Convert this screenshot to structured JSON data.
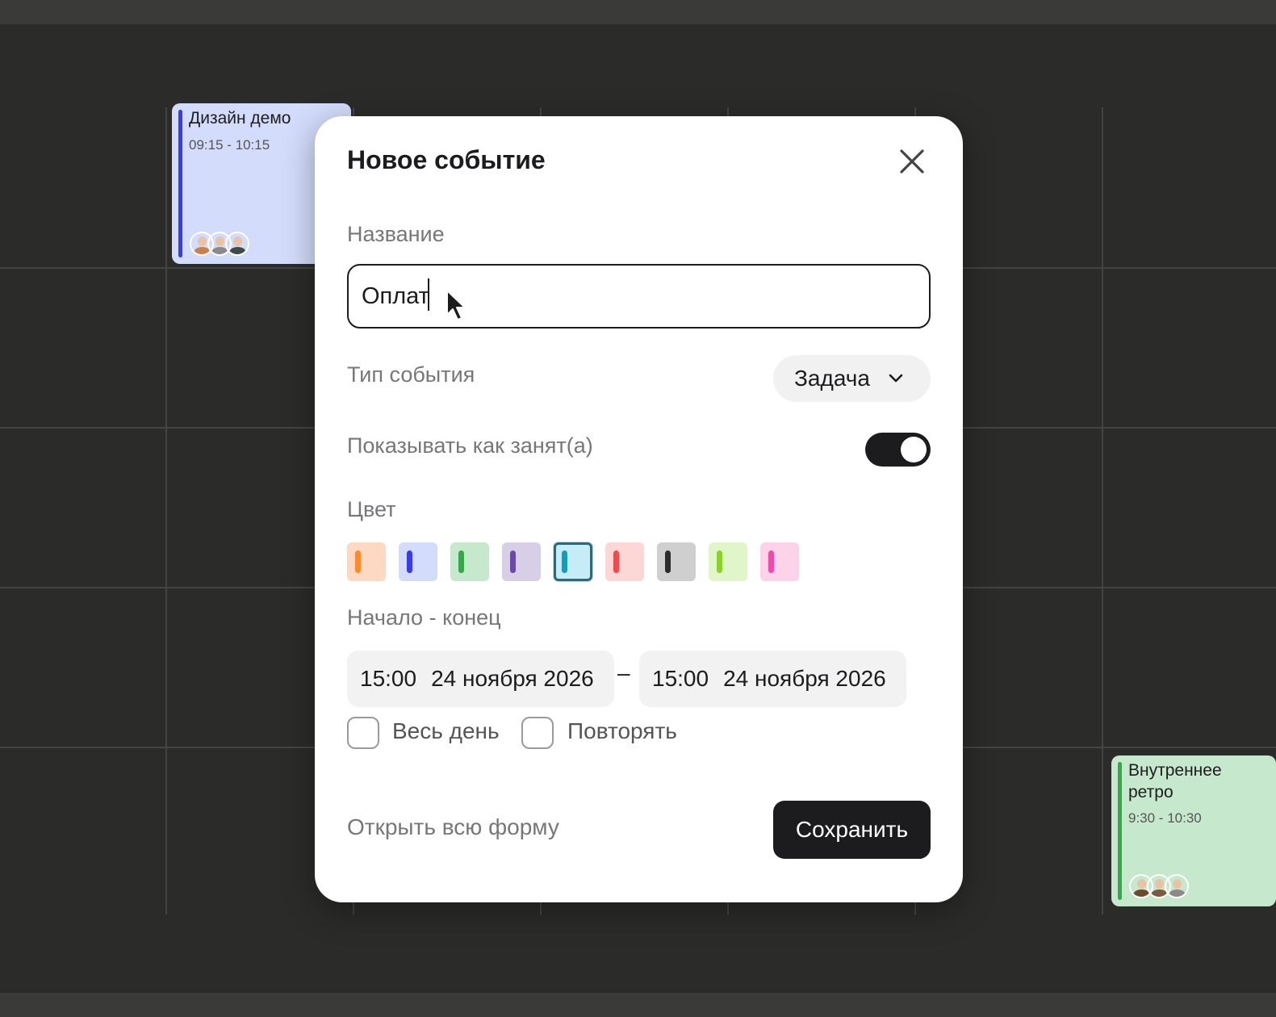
{
  "calendar": {
    "events": [
      {
        "title": "Дизайн демо",
        "time": "09:15 - 10:15",
        "background": "#d3dcfb",
        "accent": "#3a3af2",
        "attendees": [
          {
            "name": "attendee-1",
            "shirt": "#c8814a"
          },
          {
            "name": "attendee-2",
            "shirt": "#8a8a8a"
          },
          {
            "name": "attendee-3",
            "shirt": "#3f4a4a"
          }
        ]
      },
      {
        "title": "Внутреннее ретро",
        "time": "9:30 - 10:30",
        "background": "#c6e8cc",
        "accent": "#35a84a",
        "attendees": [
          {
            "name": "attendee-1",
            "shirt": "#6b4a30"
          },
          {
            "name": "attendee-2",
            "shirt": "#7a5a40"
          },
          {
            "name": "attendee-3",
            "shirt": "#8a8a8a"
          }
        ]
      }
    ]
  },
  "modal": {
    "title": "Новое событие",
    "close_icon": "close-icon",
    "name_label": "Название",
    "name_value": "Оплат",
    "type_label": "Тип события",
    "type_value": "Задача",
    "busy_label": "Показывать как занят(а)",
    "busy_enabled": true,
    "color_label": "Цвет",
    "colors": [
      {
        "id": "orange",
        "bg": "#fdd9c4",
        "bar": "#ff8a2b"
      },
      {
        "id": "blue",
        "bg": "#d3dcfb",
        "bar": "#3a3af2"
      },
      {
        "id": "green",
        "bg": "#c6e8cc",
        "bar": "#35a84a"
      },
      {
        "id": "purple",
        "bg": "#d6cfe6",
        "bar": "#6a4aa8"
      },
      {
        "id": "cyan",
        "bg": "#c6ecf8",
        "bar": "#1a9ab8",
        "selected": true
      },
      {
        "id": "red",
        "bg": "#fdd6d6",
        "bar": "#f24a4a"
      },
      {
        "id": "gray",
        "bg": "#cfcfcf",
        "bar": "#2b2b2b"
      },
      {
        "id": "lime",
        "bg": "#e0f5c8",
        "bar": "#8ad22a"
      },
      {
        "id": "pink",
        "bg": "#fdd3ea",
        "bar": "#f24aa8"
      }
    ],
    "range_label": "Начало - конец",
    "start": {
      "time": "15:00",
      "date": "24 ноября 2026"
    },
    "range_separator": "–",
    "end": {
      "time": "15:00",
      "date": "24 ноября 2026"
    },
    "all_day_label": "Весь день",
    "repeat_label": "Повторять",
    "open_form_label": "Открыть всю форму",
    "save_label": "Сохранить"
  }
}
